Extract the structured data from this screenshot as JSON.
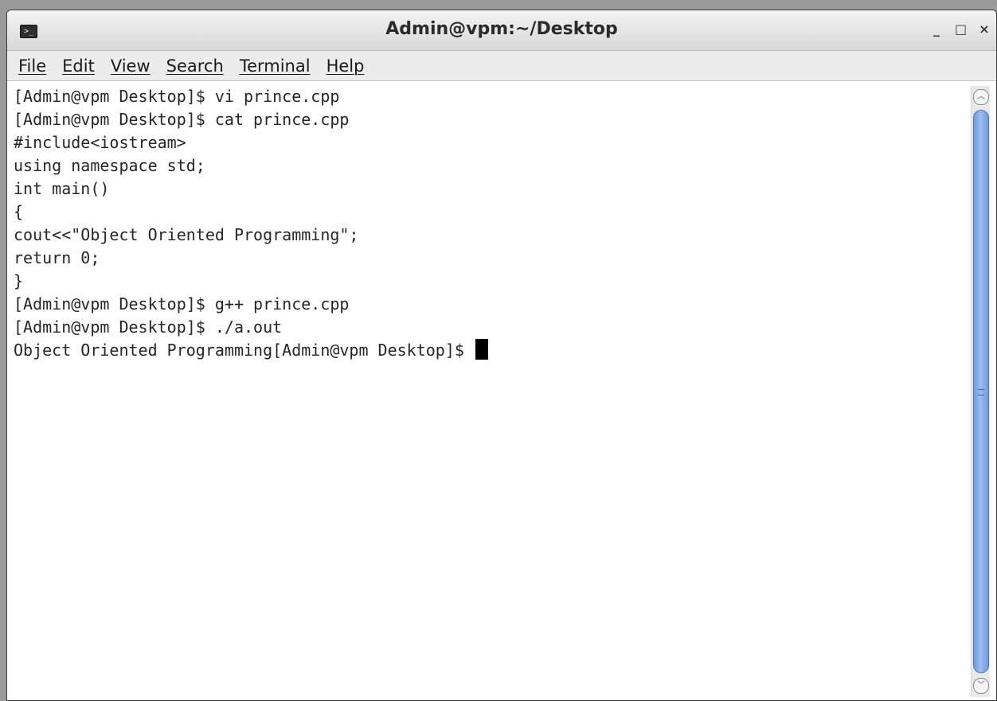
{
  "window": {
    "title": "Admin@vpm:~/Desktop",
    "app_icon": "terminal-icon",
    "app_icon_glyph": ">_",
    "minimize_glyph": "_",
    "maximize_glyph": "□",
    "close_glyph": "×"
  },
  "menu": [
    {
      "label": "File"
    },
    {
      "label": "Edit"
    },
    {
      "label": "View"
    },
    {
      "label": "Search"
    },
    {
      "label": "Terminal"
    },
    {
      "label": "Help"
    }
  ],
  "terminal": {
    "lines": [
      "[Admin@vpm Desktop]$ vi prince.cpp",
      "[Admin@vpm Desktop]$ cat prince.cpp",
      "#include<iostream>",
      "using namespace std;",
      "int main()",
      "{",
      "cout<<\"Object Oriented Programming\";",
      "return 0;",
      "}",
      "[Admin@vpm Desktop]$ g++ prince.cpp",
      "[Admin@vpm Desktop]$ ./a.out",
      "Object Oriented Programming[Admin@vpm Desktop]$ "
    ]
  },
  "colors": {
    "text": "#262626",
    "scroll_thumb": "#7aa2e6",
    "background": "#ffffff"
  }
}
